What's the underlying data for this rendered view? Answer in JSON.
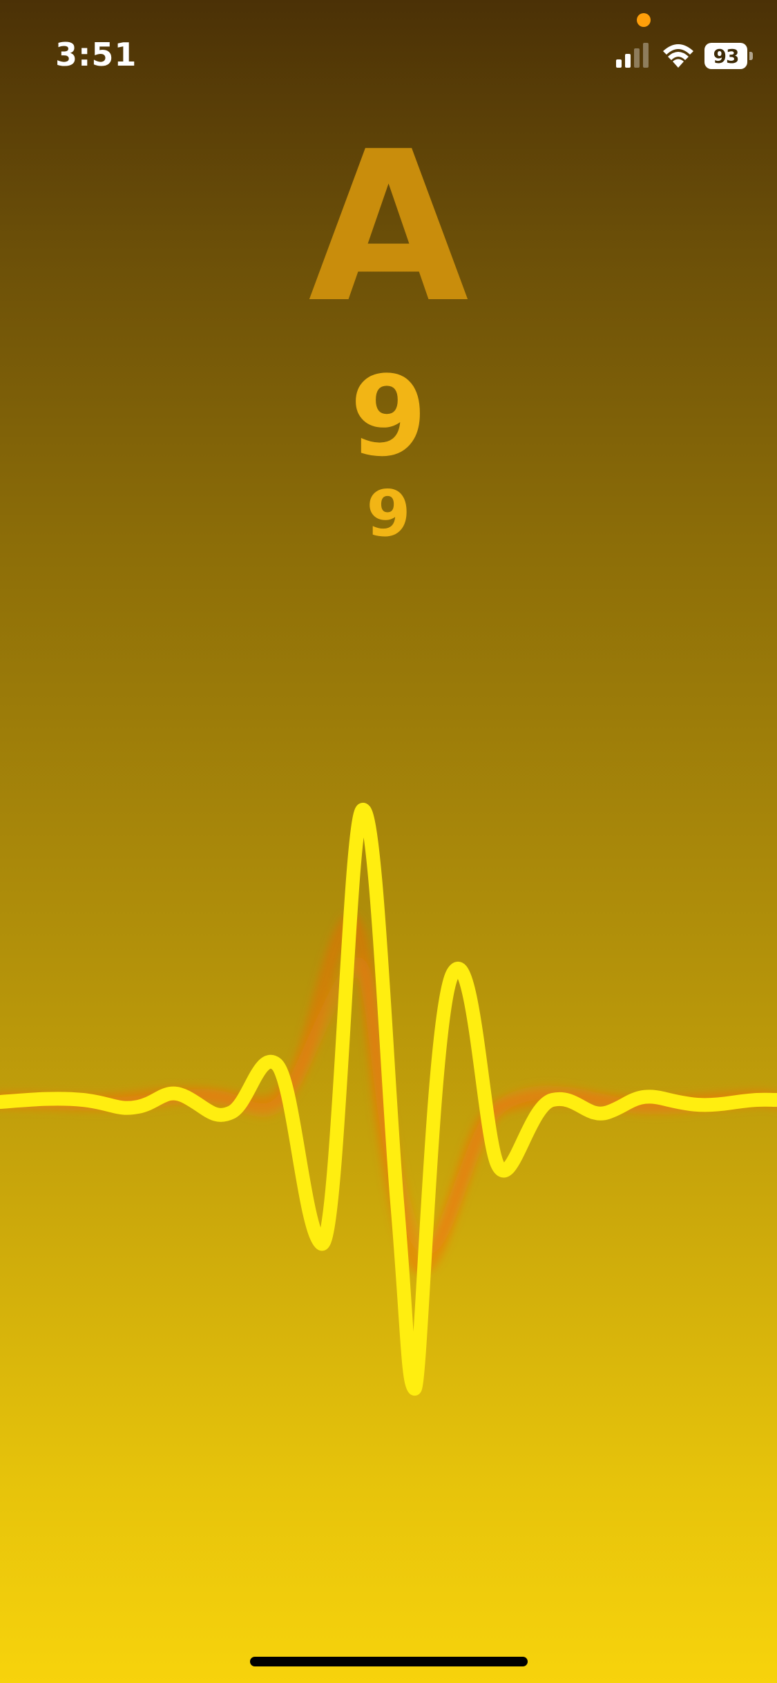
{
  "status_bar": {
    "time": "3:51",
    "battery_level": "93",
    "privacy_dot_color": "#ff9f0a"
  },
  "tuner": {
    "note": "A",
    "primary_reading": "9",
    "secondary_reading": "9"
  },
  "colors": {
    "background_top": "#4b3106",
    "background_bottom": "#f7d30c",
    "note_color": "#c98d0c",
    "reading_color": "#f2b515",
    "wave_main": "#ffee10",
    "wave_echo": "#ff5a0a"
  }
}
